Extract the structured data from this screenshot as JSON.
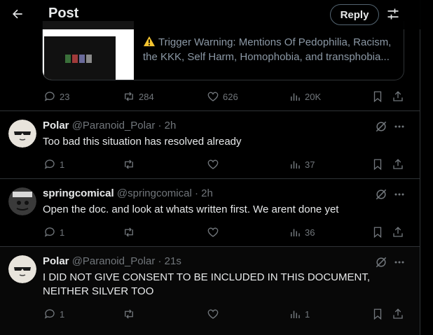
{
  "header": {
    "title": "Post",
    "reply_button": "Reply"
  },
  "quote": {
    "text": "Trigger Warning: Mentions Of Pedophilia, Racism, the KKK, Self Harm, Homophobia, and transphobia..."
  },
  "main_post": {
    "replies": "23",
    "reposts": "284",
    "likes": "626",
    "views": "20K"
  },
  "replies": [
    {
      "name": "Polar",
      "handle": "@Paranoid_Polar",
      "time": "2h",
      "text": "Too bad this situation has resolved already",
      "replies": "1",
      "views": "37"
    },
    {
      "name": "springcomical",
      "handle": "@springcomical",
      "time": "2h",
      "text": "Open the doc. and look at whats written first. We arent done yet",
      "replies": "1",
      "views": "36"
    },
    {
      "name": "Polar",
      "handle": "@Paranoid_Polar",
      "time": "21s",
      "text": "I DID NOT GIVE CONSENT TO BE INCLUDED IN THIS DOCUMENT, NEITHER SILVER TOO",
      "replies": "1",
      "views": "1"
    }
  ],
  "separator": "·",
  "colors": {
    "background": "#000000",
    "text": "#e7e9ea",
    "muted": "#71767b",
    "border": "#2f3336"
  }
}
